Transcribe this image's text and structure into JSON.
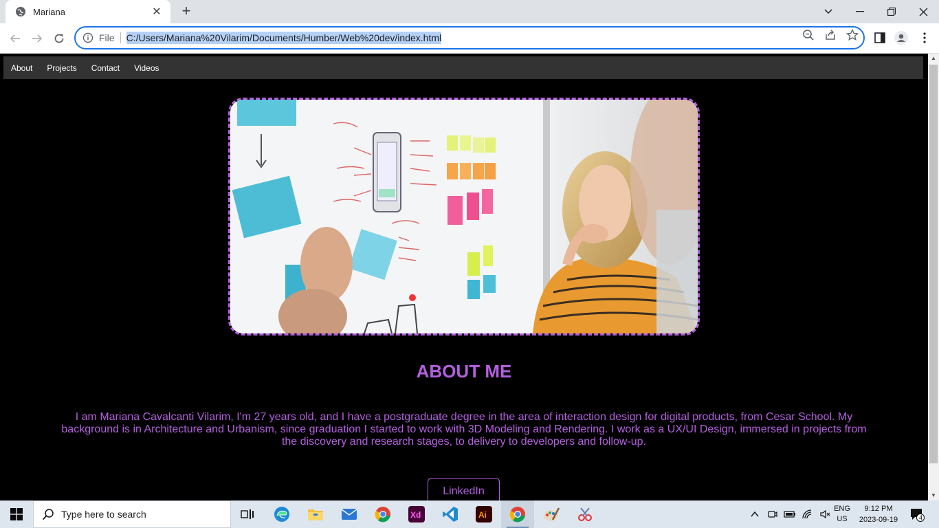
{
  "browser": {
    "tab_title": "Mariana",
    "new_tab": "+",
    "file_label": "File",
    "url": "C:/Users/Mariana%20Vilarim/Documents/Humber/Web%20dev/index.html"
  },
  "site": {
    "nav": [
      "About",
      "Projects",
      "Contact",
      "Videos"
    ],
    "about_title": "ABOUT ME",
    "about_text": "I am Mariana Cavalcanti Vilarim, I'm 27 years old, and I have a postgraduate degree in the area of interaction design for digital products, from Cesar School. My background is in Architecture and Urbanism, since graduation I started to work with 3D Modeling and Rendering. I work as a UX/UI Design, immersed in projects from the discovery and research stages, to delivery to developers and follow-up.",
    "linkedin": "LinkedIn",
    "accent_color": "#b55fe0"
  },
  "taskbar": {
    "search_placeholder": "Type here to search",
    "lang_line1": "ENG",
    "lang_line2": "US",
    "time": "9:12 PM",
    "date": "2023-09-19",
    "notifications": "4"
  }
}
